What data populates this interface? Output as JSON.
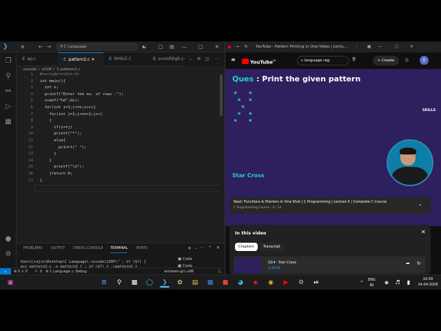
{
  "vscode": {
    "search": "C Language",
    "tabs": [
      {
        "label": "ap.c",
        "active": false
      },
      {
        "label": "pattern2.c",
        "active": true
      },
      {
        "label": "WHILE.C",
        "active": false
      },
      {
        "label": "sumofdigit.c",
        "active": false
      }
    ],
    "breadcrumb": ".vscode 〉LOOP 〉C pattern2.c",
    "lines": [
      {
        "n": "1",
        "code": "#include<stdio.h>"
      },
      {
        "n": "2",
        "code": "int main(){"
      },
      {
        "n": "3",
        "code": "  int n;"
      },
      {
        "n": "4",
        "code": "  printf(\"Enter the no. of rows :\");"
      },
      {
        "n": "5",
        "code": "  scanf(\"%d\",&n);"
      },
      {
        "n": "6",
        "code": "  for(int i=1;i<=n;i++){"
      },
      {
        "n": "7",
        "code": "    for(int j=1;j<=n+2;j++)"
      },
      {
        "n": "8",
        "code": "    {"
      },
      {
        "n": "9",
        "code": "      if(i==j)"
      },
      {
        "n": "10",
        "code": "      printf(\"*\");"
      },
      {
        "n": "11",
        "code": "      else{"
      },
      {
        "n": "12",
        "code": "        printf(\" \");"
      },
      {
        "n": "13",
        "code": "      }"
      },
      {
        "n": "14",
        "code": "    }"
      },
      {
        "n": "15",
        "code": "      printf(\"\\n\");"
      },
      {
        "n": "16",
        "code": "    }return 0;"
      },
      {
        "n": "17",
        "code": "}"
      }
    ],
    "panel_tabs": [
      "PROBLEMS",
      "OUTPUT",
      "DEBUG CONSOLE",
      "TERMINAL",
      "PORTS"
    ],
    "terminal": "Users\\rajiv\\Desktop\\C Language\\.vscode\\LOOP\\\" ; if ($?) {\ngcc pattern2.c -o pattern2 } ; if ($?) { .\\pattern2 }\nEnter the no. of rows :4\n******\n*    *\n*    *\n******\nPS C:\\Users\\rajiv\\Desktop\\C Language\\.vscode\\LOOP> ",
    "terminal_list": [
      "Code",
      "Code"
    ],
    "status": {
      "problems": "⊗ 0 ⚠ 0",
      "ports": "0",
      "language": "C Language",
      "debug": "Debug",
      "compiler": "windows-gcc-x86"
    }
  },
  "browser": {
    "tab_title": "YouTube - Pattern Printing in One Video | Lectu...",
    "yt_logo": "YouTube",
    "region": "IN",
    "search_value": "c language rag",
    "create": "Create",
    "avatar": "D",
    "video_title_prefix": "Ques",
    "video_title": ": Print the given pattern",
    "video_stars": "*   *\n *  *\n  *\n *  *\n*   *",
    "video_subtitle": "Star Cross",
    "skills_logo": "SKILLS",
    "next_title": "Next: Functions & Pointers in One Shot | C Programming | Lecture 5 | Complete C Course",
    "next_sub": "C Programming Course - 4 / 12",
    "in_this_video": "In this video",
    "chapters": "Chapters",
    "transcript": "Transcript",
    "chapter_title": "Q14 - Star Cross",
    "chapter_time": "1:39:54"
  },
  "taskbar": {
    "lang1": "ENG",
    "lang2": "IN",
    "time": "10:59",
    "date": "14-04-2026"
  }
}
